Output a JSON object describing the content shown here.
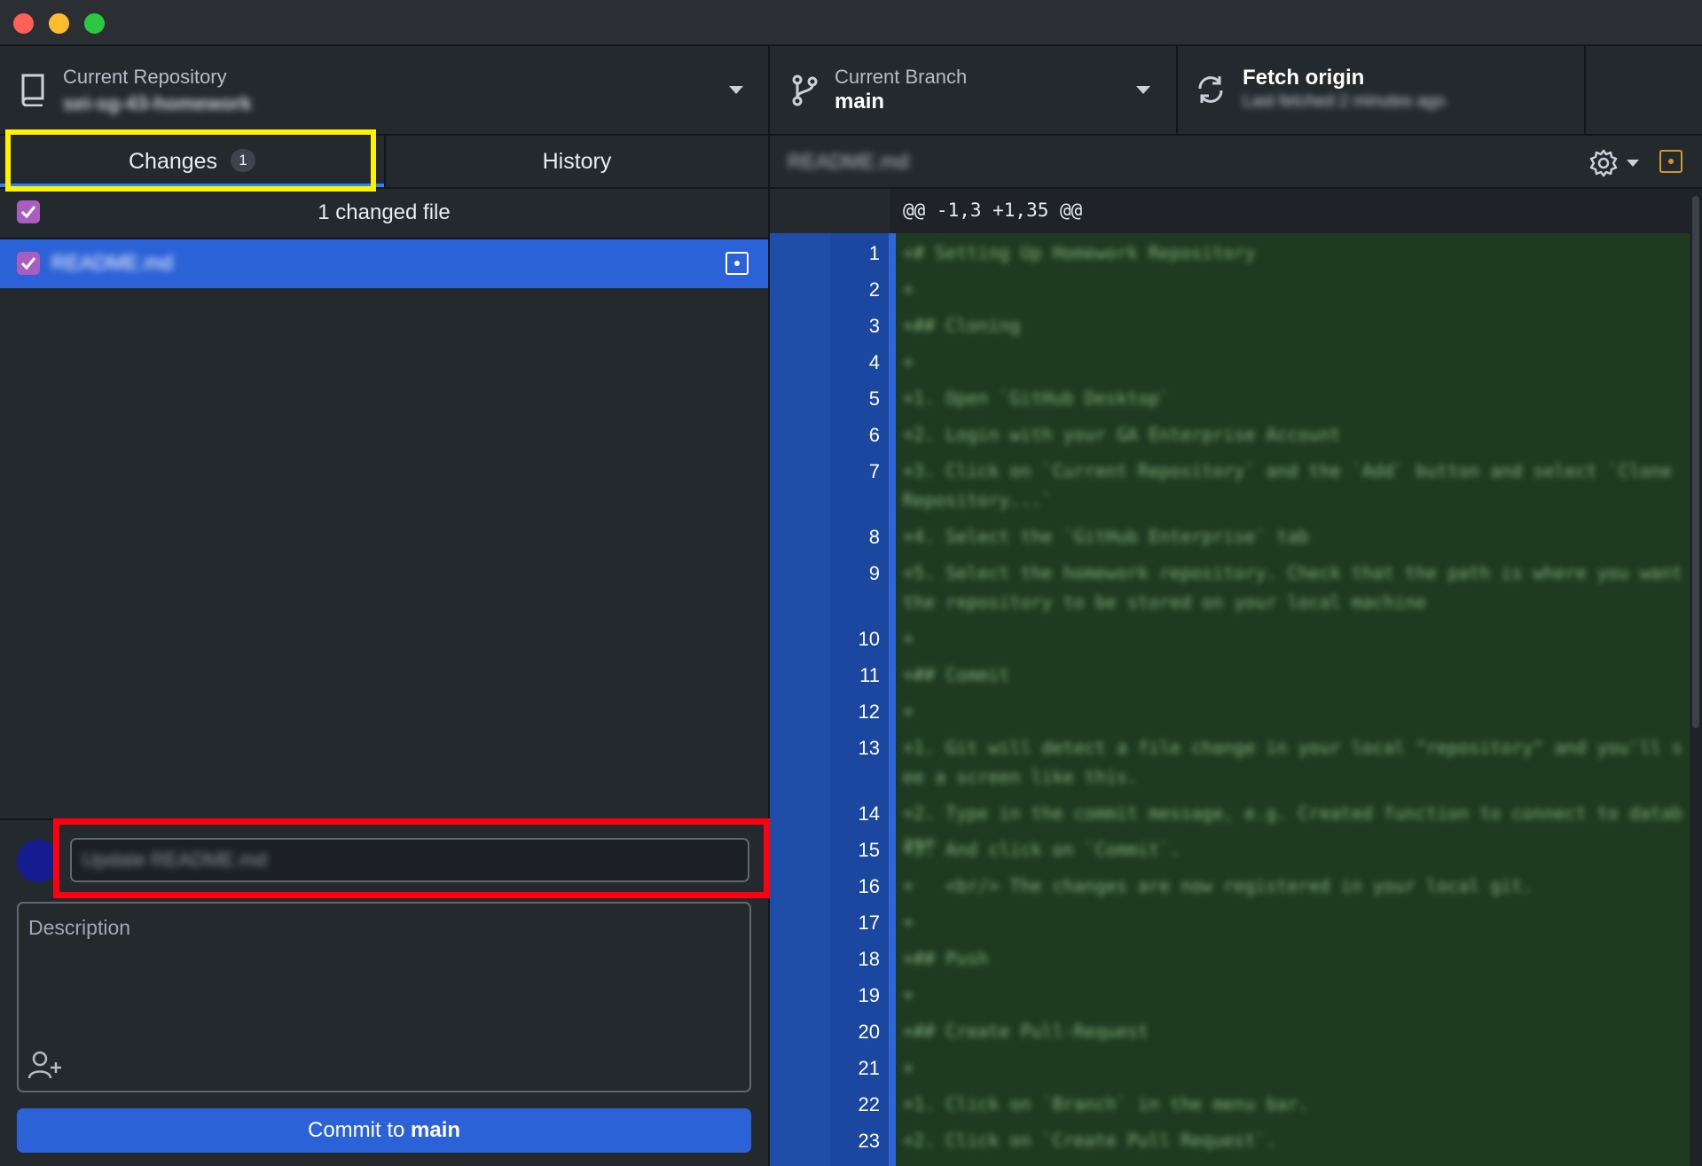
{
  "toolbar": {
    "repo_label": "Current Repository",
    "repo_name": "sei-sg-43-homework",
    "branch_label": "Current Branch",
    "branch_name": "main",
    "fetch_label": "Fetch origin",
    "fetch_sub": "Last fetched 2 minutes ago"
  },
  "tabs": {
    "changes_label": "Changes",
    "changes_count": "1",
    "history_label": "History"
  },
  "changes": {
    "header": "1 changed file",
    "files": [
      {
        "name": "README.md"
      }
    ]
  },
  "commit": {
    "summary_placeholder": "Update README.md",
    "description_placeholder": "Description",
    "button_prefix": "Commit to ",
    "button_branch": "main"
  },
  "diff": {
    "filename": "README.md",
    "hunk": "@@ -1,3 +1,35 @@",
    "lines": [
      {
        "n": "1",
        "text": "+# Setting Up Homework Repository"
      },
      {
        "n": "2",
        "text": "+"
      },
      {
        "n": "3",
        "text": "+## Cloning"
      },
      {
        "n": "4",
        "text": "+"
      },
      {
        "n": "5",
        "text": "+1. Open `GitHub Desktop`"
      },
      {
        "n": "6",
        "text": "+2. Login with your GA Enterprise Account"
      },
      {
        "n": "7",
        "text": "+3. Click on `Current Repository` and the `Add` button and select `Clone Repository...`"
      },
      {
        "n": "8",
        "text": "+4. Select the `GitHub Enterprise` tab"
      },
      {
        "n": "9",
        "text": "+5. Select the homework repository. Check that the path is where you want the repository to be stored on your local machine"
      },
      {
        "n": "10",
        "text": "+"
      },
      {
        "n": "11",
        "text": "+## Commit"
      },
      {
        "n": "12",
        "text": "+"
      },
      {
        "n": "13",
        "text": "+1. Git will detect a file change in your local \"repository\" and you'll see a screen like this."
      },
      {
        "n": "14",
        "text": "+2. Type in the commit message, e.g. Created function to connect to database"
      },
      {
        "n": "15",
        "text": "+3. And click on `Commit`."
      },
      {
        "n": "16",
        "text": "+   <br/> The changes are now registered in your local git."
      },
      {
        "n": "17",
        "text": "+"
      },
      {
        "n": "18",
        "text": "+## Push"
      },
      {
        "n": "19",
        "text": "+"
      },
      {
        "n": "20",
        "text": "+## Create Pull-Request"
      },
      {
        "n": "21",
        "text": "+"
      },
      {
        "n": "22",
        "text": "+1. Click on `Branch` in the menu bar."
      },
      {
        "n": "23",
        "text": "+2. Click on `Create Pull Request`."
      }
    ]
  },
  "colors": {
    "accent": "#2c62d8",
    "highlight_yellow": "#fff200",
    "highlight_red": "#ff0010",
    "checkbox": "#a95dbe",
    "added_bg": "#1e3a20"
  }
}
